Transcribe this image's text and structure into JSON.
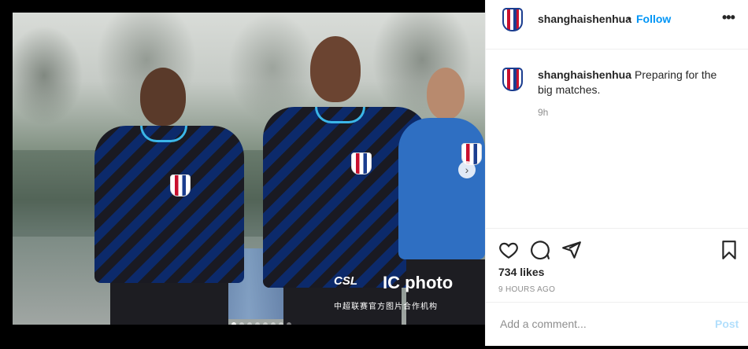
{
  "post": {
    "username": "shanghaishenhua",
    "follow_label": "Follow",
    "separator": "•",
    "more_icon": "more-horizontal-icon",
    "caption": "Preparing for the big matches.",
    "caption_age": "9h",
    "likes": "734 likes",
    "post_age": "9 HOURS AGO"
  },
  "photo": {
    "watermark_brand": "CSL",
    "watermark_photo": "IC photo",
    "watermark_cn": "中超联赛官方图片合作机构",
    "carousel_total": 8,
    "carousel_current": 1
  },
  "actions": {
    "like_icon": "heart-icon",
    "comment_icon": "comment-icon",
    "share_icon": "share-icon",
    "save_icon": "bookmark-icon"
  },
  "comment": {
    "placeholder": "Add a comment...",
    "post_label": "Post"
  },
  "colors": {
    "accent": "#0095f6",
    "post_disabled": "#b2dffc"
  }
}
